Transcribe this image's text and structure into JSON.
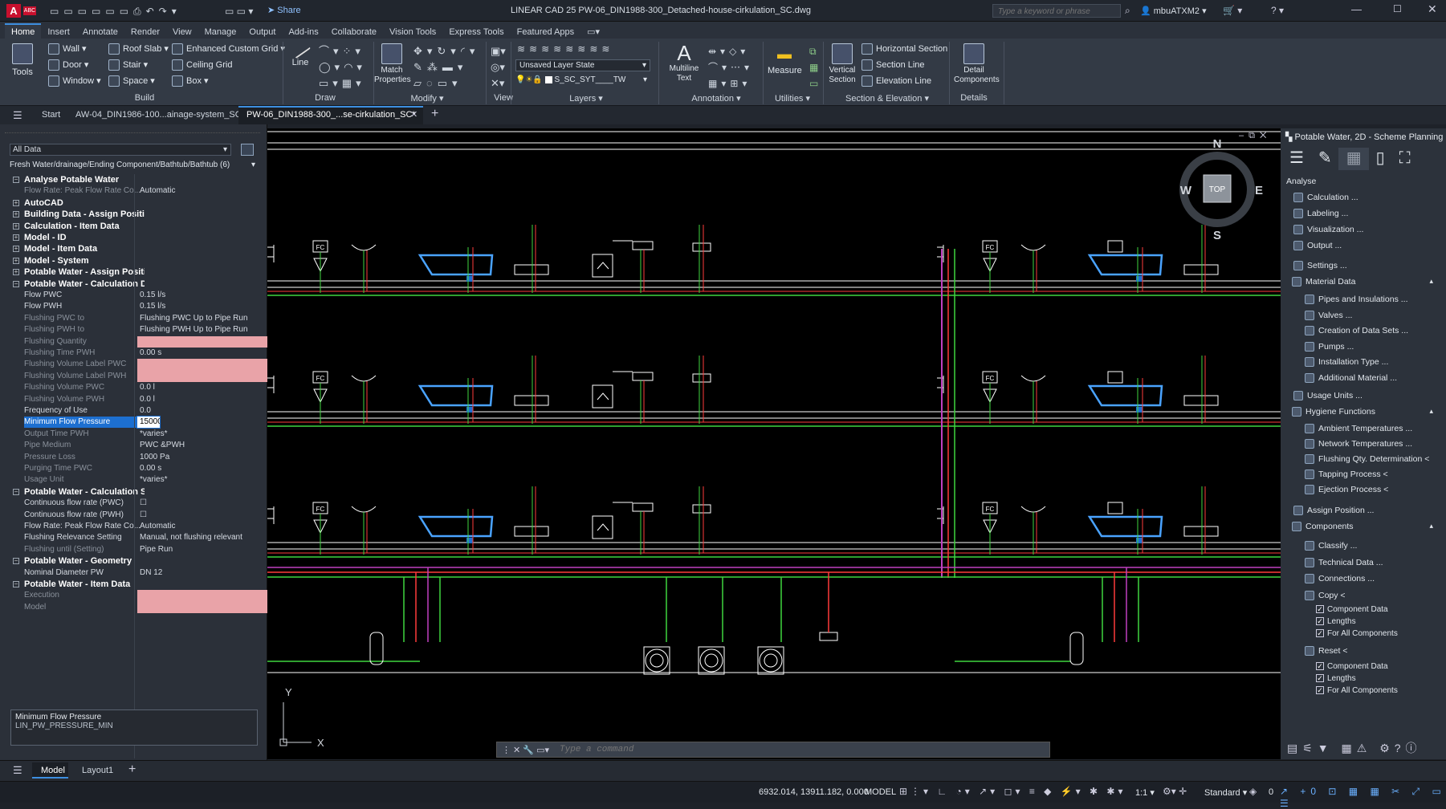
{
  "app": {
    "logo": "A",
    "badge": "ABC",
    "title": "LINEAR CAD 25   PW-06_DIN1988-300_Detached-house-cirkulation_SC.dwg",
    "search_placeholder": "Type a keyword or phrase",
    "user": "mbuATXM2",
    "share": "Share"
  },
  "ribbon_tabs": [
    "Home",
    "Insert",
    "Annotate",
    "Render",
    "View",
    "Manage",
    "Output",
    "Add-ins",
    "Collaborate",
    "Vision Tools",
    "Express Tools",
    "Featured Apps"
  ],
  "ribbon": {
    "tools": "Tools",
    "build": {
      "items": [
        "Wall",
        "Door",
        "Window",
        "Roof Slab",
        "Stair",
        "Space",
        "Enhanced Custom Grid",
        "Ceiling Grid",
        "Box"
      ],
      "name": "Build"
    },
    "draw": {
      "line": "Line",
      "name": "Draw"
    },
    "modify": {
      "match": "Match Properties",
      "name": "Modify"
    },
    "view": {
      "name": "View"
    },
    "layers": {
      "state": "Unsaved Layer State",
      "layer": "S_SC_SYT____TW",
      "name": "Layers"
    },
    "annotation": {
      "mtext": "Multiline Text",
      "name": "Annotation"
    },
    "utilities": {
      "measure": "Measure",
      "name": "Utilities"
    },
    "section": {
      "vertical": "Vertical Section",
      "items": [
        "Horizontal Section",
        "Section Line",
        "Elevation Line"
      ],
      "name": "Section & Elevation"
    },
    "details": {
      "detail": "Detail Components",
      "name": "Details"
    }
  },
  "doc_tabs": [
    "Start",
    "AW-04_DIN1986-100...ainage-system_SC*",
    "PW-06_DIN1988-300_...se-cirkulation_SC*"
  ],
  "left": {
    "filter": "All Data",
    "path": "Fresh Water/drainage/Ending Component/Bathtub/Bathtub (6)",
    "rows": [
      {
        "k": "Analyse Potable Water",
        "v": "",
        "t": "grp"
      },
      {
        "k": "Flow Rate: Peak Flow Rate Co...",
        "v": "Automatic",
        "t": "dis"
      },
      {
        "k": "AutoCAD",
        "v": "",
        "t": "grp"
      },
      {
        "k": "Building Data - Assign Position",
        "v": "",
        "t": "grp"
      },
      {
        "k": "Calculation - Item Data",
        "v": "",
        "t": "grp"
      },
      {
        "k": "Model - ID",
        "v": "",
        "t": "grp"
      },
      {
        "k": "Model - Item Data",
        "v": "",
        "t": "grp"
      },
      {
        "k": "Model - System",
        "v": "",
        "t": "grp"
      },
      {
        "k": "Potable Water - Assign Position",
        "v": "",
        "t": "grp"
      },
      {
        "k": "Potable Water - Calculation Data",
        "v": "",
        "t": "grp"
      },
      {
        "k": "Flow PWC",
        "v": "0.15 l/s",
        "t": ""
      },
      {
        "k": "Flow PWH",
        "v": "0.15 l/s",
        "t": ""
      },
      {
        "k": "Flushing PWC to",
        "v": "Flushing PWC Up to Pipe Run",
        "t": "dis"
      },
      {
        "k": "Flushing PWH to",
        "v": "Flushing PWH Up to Pipe Run",
        "t": "dis"
      },
      {
        "k": "Flushing Quantity",
        "v": "",
        "t": "pink dis"
      },
      {
        "k": "Flushing Time PWH",
        "v": "0.00 s",
        "t": "dis"
      },
      {
        "k": "Flushing Volume Label PWC",
        "v": "",
        "t": "pink dis"
      },
      {
        "k": "Flushing Volume Label PWH",
        "v": "",
        "t": "pink dis"
      },
      {
        "k": "Flushing Volume PWC",
        "v": "0.0 l",
        "t": "dis"
      },
      {
        "k": "Flushing Volume PWH",
        "v": "0.0 l",
        "t": "dis"
      },
      {
        "k": "Frequency of Use",
        "v": "0.0",
        "t": ""
      },
      {
        "k": "Minimum Flow Pressure",
        "v": "150000",
        "t": "sel"
      },
      {
        "k": "Output Time PWH",
        "v": "*varies*",
        "t": "dis"
      },
      {
        "k": "Pipe Medium",
        "v": "PWC &PWH",
        "t": "dis"
      },
      {
        "k": "Pressure Loss",
        "v": "1000 Pa",
        "t": "dis"
      },
      {
        "k": "Purging Time PWC",
        "v": "0.00 s",
        "t": "dis"
      },
      {
        "k": "Usage Unit",
        "v": "*varies*",
        "t": "dis"
      },
      {
        "k": "Potable Water - Calculation Setting",
        "v": "",
        "t": "grp"
      },
      {
        "k": "Continuous flow rate (PWC)",
        "v": "☐",
        "t": ""
      },
      {
        "k": "Continuous flow rate (PWH)",
        "v": "☐",
        "t": ""
      },
      {
        "k": "Flow Rate: Peak Flow Rate Co...",
        "v": "Automatic",
        "t": ""
      },
      {
        "k": "Flushing Relevance Setting",
        "v": "Manual, not flushing relevant",
        "t": ""
      },
      {
        "k": "Flushing until (Setting)",
        "v": "Pipe Run",
        "t": "dis"
      },
      {
        "k": "Potable Water - Geometry",
        "v": "",
        "t": "grp"
      },
      {
        "k": "Nominal Diameter PW",
        "v": "DN 12",
        "t": ""
      },
      {
        "k": "Potable Water - Item Data",
        "v": "",
        "t": "grp"
      },
      {
        "k": "Execution",
        "v": "",
        "t": "pink dis"
      },
      {
        "k": "Model",
        "v": "",
        "t": "pink dis"
      }
    ],
    "desc_title": "Minimum Flow Pressure",
    "desc_id": "LIN_PW_PRESSURE_MIN"
  },
  "right": {
    "title": "Potable Water, 2D - Scheme Planning",
    "analyse": "Analyse",
    "items": [
      "Calculation ...",
      "Labeling ...",
      "Visualization ...",
      "Output ..."
    ],
    "settings": "Settings ...",
    "material": "Material Data",
    "material_items": [
      "Pipes and Insulations ...",
      "Valves ...",
      "Creation of Data Sets ...",
      "Pumps ...",
      "Installation Type ...",
      "Additional Material ..."
    ],
    "usage": "Usage Units ...",
    "hygiene": "Hygiene Functions",
    "hygiene_items": [
      "Ambient Temperatures ...",
      "Network Temperatures ...",
      "Flushing Qty. Determination <",
      "Tapping Process <",
      "Ejection Process <"
    ],
    "assign": "Assign Position ...",
    "components": "Components",
    "comp_items": [
      "Classify ...",
      "Technical Data ...",
      "Connections ..."
    ],
    "copy": "Copy <",
    "copy_checks": [
      "Component Data",
      "Lengths",
      "For All Components"
    ],
    "reset": "Reset <",
    "reset_checks": [
      "Component Data",
      "Lengths",
      "For All Components"
    ]
  },
  "drawing": {
    "compass": {
      "n": "N",
      "s": "S",
      "e": "E",
      "w": "W",
      "top": "TOP"
    },
    "ucs_x": "X",
    "ucs_y": "Y",
    "cmd_placeholder": "Type a command"
  },
  "layout_tabs": [
    "Model",
    "Layout1"
  ],
  "status": {
    "coords": "6932.014, 13911.182, 0.000",
    "model": "MODEL",
    "scale": "1:1",
    "style": "Standard",
    "zero": "0"
  }
}
